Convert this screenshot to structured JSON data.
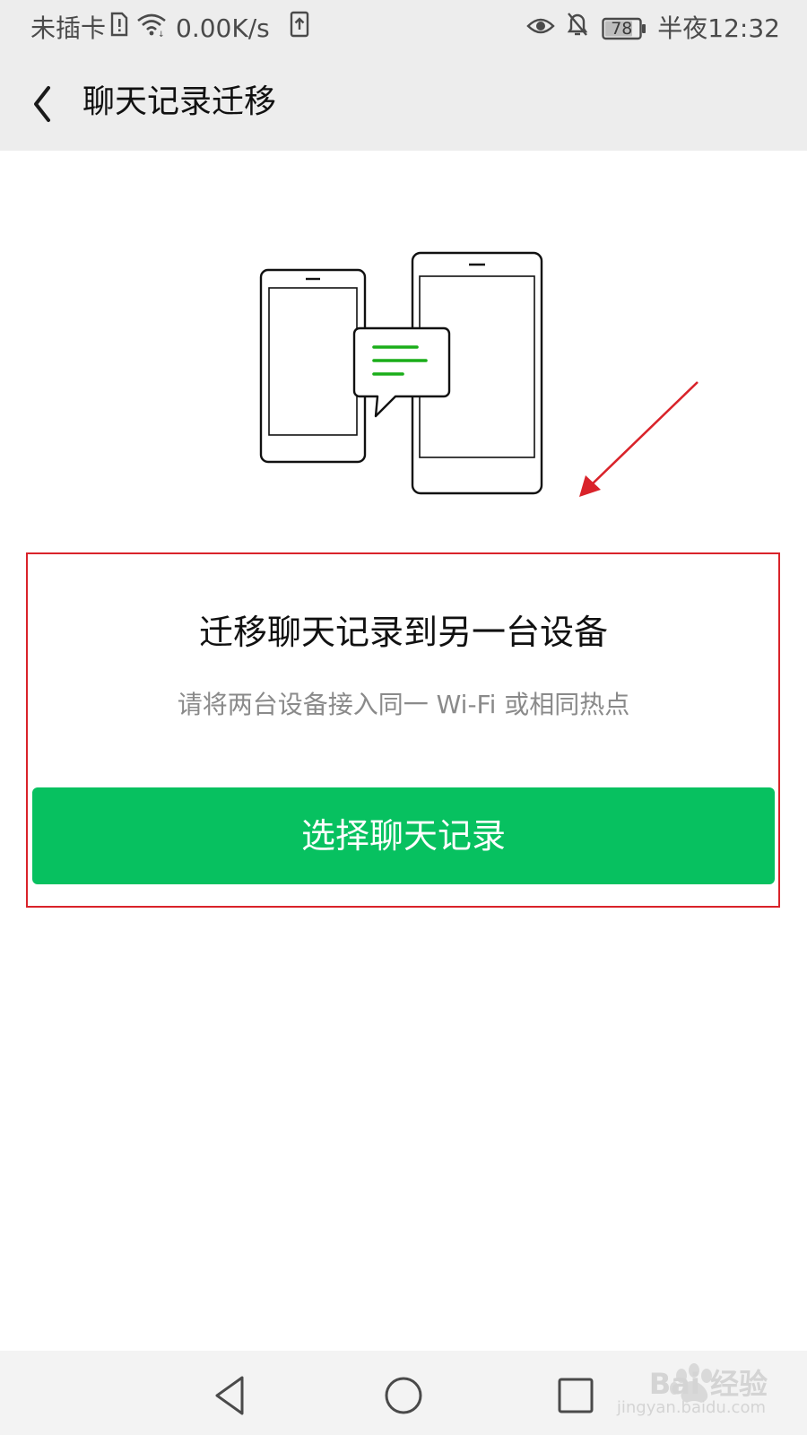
{
  "status_bar": {
    "carrier": "未插卡",
    "speed": "0.00K/s",
    "battery": "78",
    "time": "半夜12:32"
  },
  "header": {
    "title": "聊天记录迁移"
  },
  "main": {
    "headline": "迁移聊天记录到另一台设备",
    "subtitle": "请将两台设备接入同一 Wi-Fi 或相同热点",
    "button_label": "选择聊天记录"
  },
  "watermark": {
    "brand": "Bai 经验",
    "url": "jingyan.baidu.com"
  },
  "colors": {
    "accent": "#07c160",
    "annotation": "#d9232a"
  }
}
